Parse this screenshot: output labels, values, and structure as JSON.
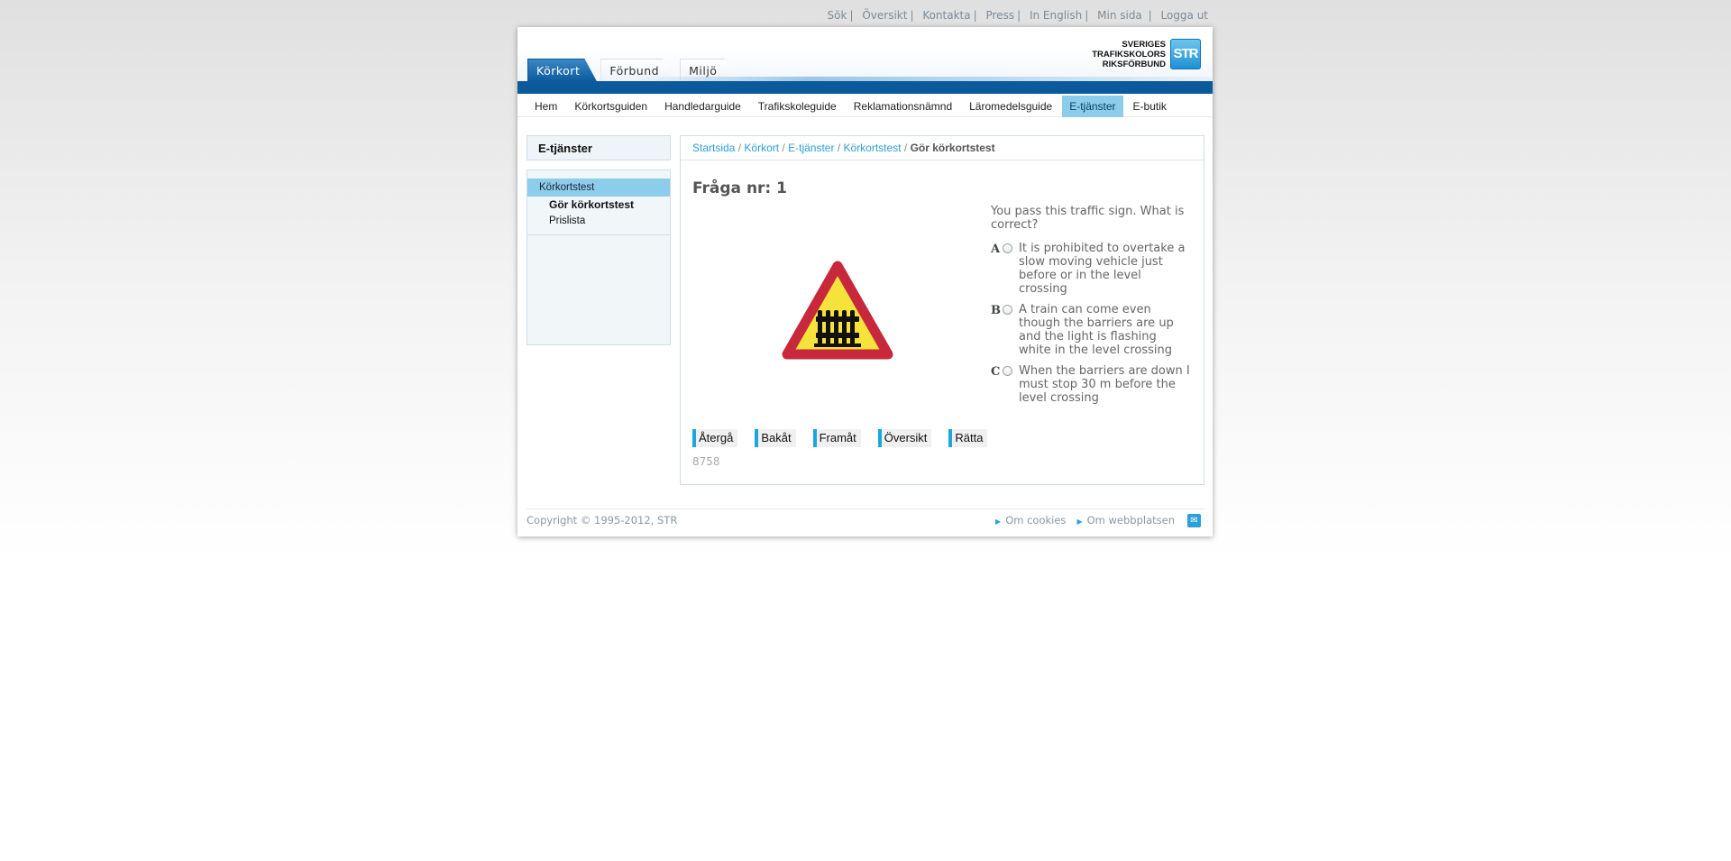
{
  "top_links": [
    "Sök",
    "Översikt",
    "Kontakta",
    "Press",
    "In English",
    "Min sida",
    "Logga ut"
  ],
  "tabs": [
    {
      "label": "Körkort"
    },
    {
      "label": "Förbund"
    },
    {
      "label": "Miljö"
    }
  ],
  "active_tab": "Körkort",
  "logo": {
    "line1": "SVERIGES",
    "line2": "TRAFIKSKOLORS",
    "line3": "RIKSFÖRBUND",
    "mark": "STR"
  },
  "nav": [
    {
      "label": "Hem"
    },
    {
      "label": "Körkortsguiden"
    },
    {
      "label": "Handledarguide"
    },
    {
      "label": "Trafikskoleguide"
    },
    {
      "label": "Reklamationsnämnd"
    },
    {
      "label": "Läromedelsguide"
    },
    {
      "label": "E-tjänster"
    },
    {
      "label": "E-butik"
    }
  ],
  "active_nav": "E-tjänster",
  "sidebar": {
    "title": "E-tjänster",
    "section": "Körkortstest",
    "items": [
      {
        "label": "Gör körkortstest"
      },
      {
        "label": "Prislista"
      }
    ]
  },
  "breadcrumb": {
    "links": [
      "Startsida",
      "Körkort",
      "E-tjänster",
      "Körkortstest"
    ],
    "separator": "/",
    "current": "Gör körkortstest"
  },
  "question": {
    "title": "Fråga nr: 1",
    "text": "You pass this traffic sign. What is correct?",
    "sign_icon": "level-crossing-with-barriers-warning-sign",
    "options": [
      {
        "letter": "A",
        "text": "It is prohibited to overtake a slow moving vehicle just before or in the level crossing"
      },
      {
        "letter": "B",
        "text": "A train can come even though the barriers are up and the light is flashing white in the level crossing"
      },
      {
        "letter": "C",
        "text": "When the barriers are down I must stop 30 m before the level crossing"
      }
    ],
    "buttons": [
      "Återgå",
      "Bakåt",
      "Framåt",
      "Översikt",
      "Rätta"
    ],
    "id": "8758"
  },
  "footer": {
    "copyright": "Copyright © 1995-2012, STR",
    "links": [
      "Om cookies",
      "Om webbplatsen"
    ]
  },
  "colors": {
    "brand_blue": "#0a5a9c",
    "accent_light_blue": "#8ccdec",
    "link_blue": "#2b9fd9",
    "sign_red": "#c8283c",
    "sign_yellow": "#f5e23a"
  }
}
